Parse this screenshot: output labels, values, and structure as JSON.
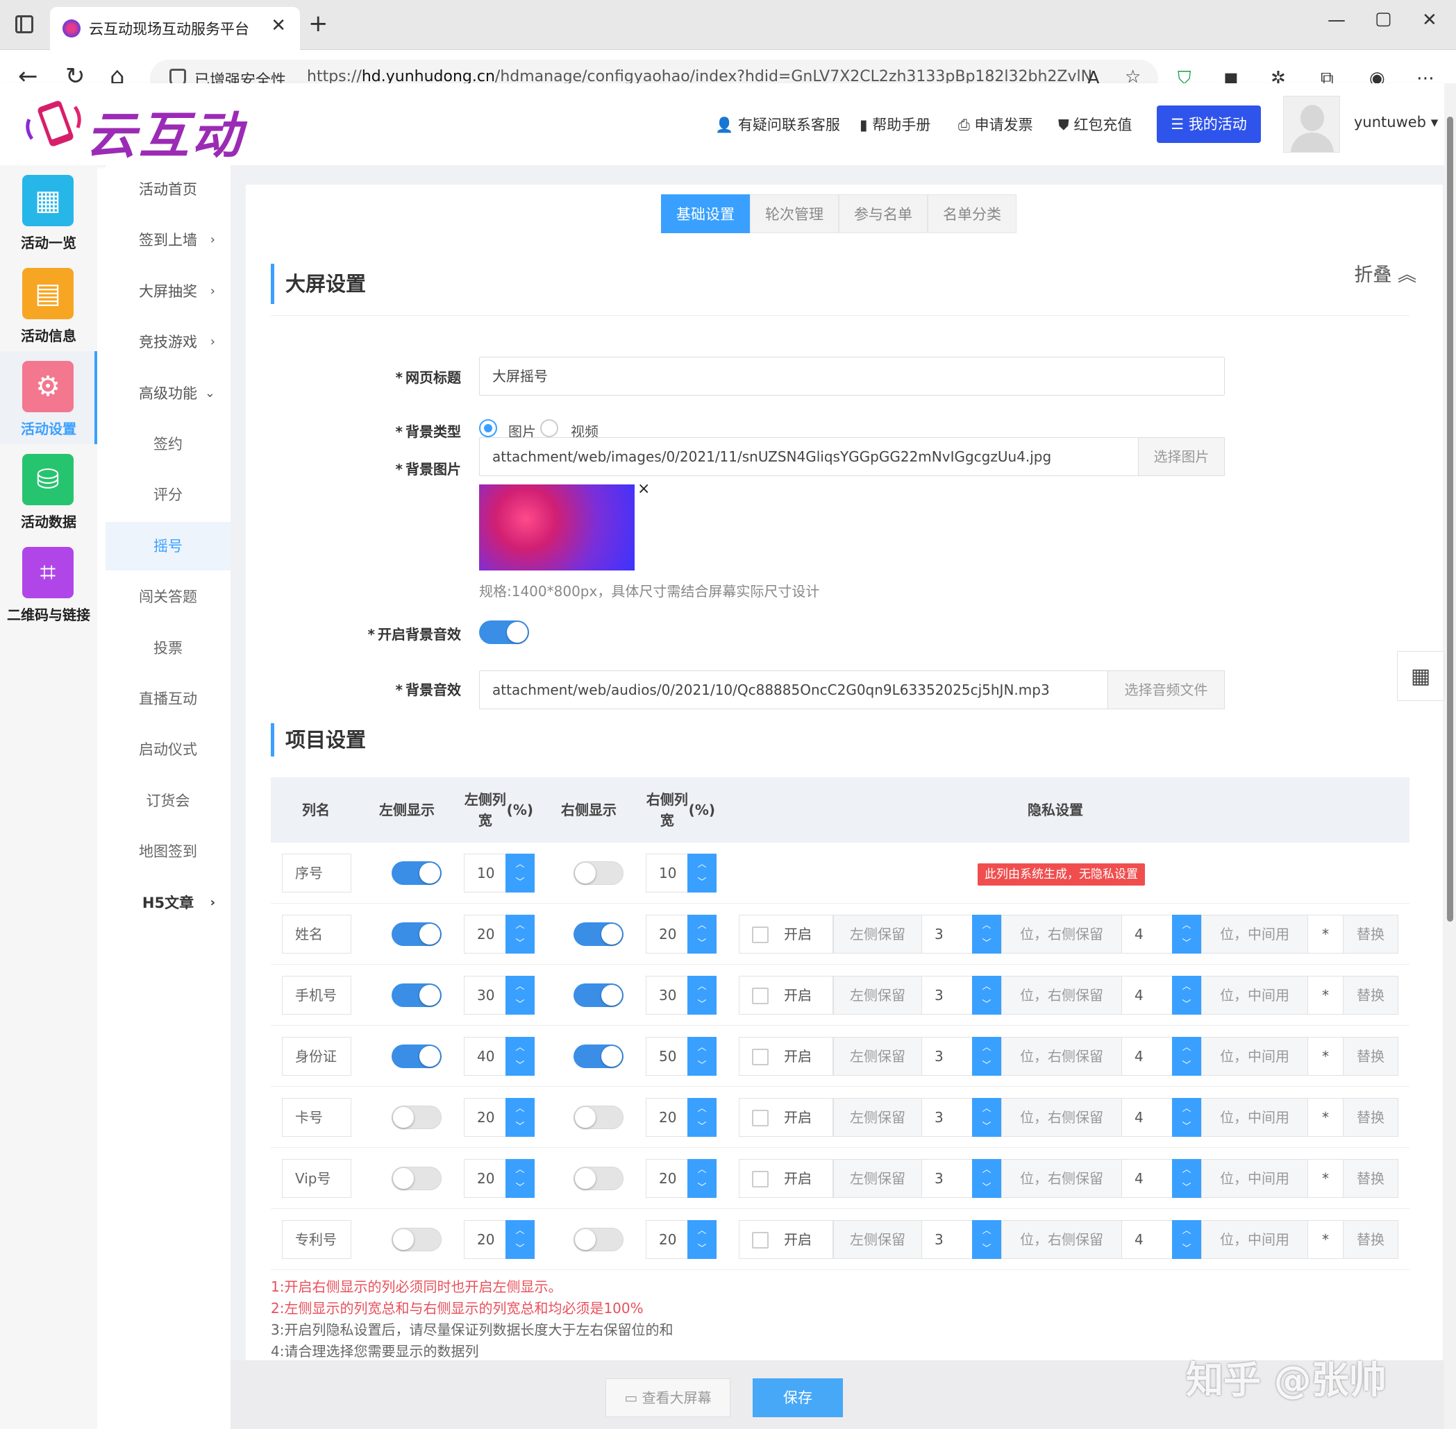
{
  "browser": {
    "tab_title": "云互动现场互动服务平台",
    "security_label": "已增强安全性",
    "url_prefix": "https://",
    "url_host": "hd.yunhudong.cn",
    "url_path": "/hdmanage/configyaohao/index?hdid=GnLV7X2CL2zh3133pBp182l32bh2ZvlN"
  },
  "header": {
    "logo_text": "云互动",
    "links": [
      "有疑问联系客服",
      "帮助手册",
      "申请发票",
      "红包充值"
    ],
    "my_activity": "我的活动",
    "username": "yuntuweb"
  },
  "rail": [
    {
      "label": "活动一览",
      "icon": "grid-icon",
      "color": "#27b6e8",
      "active": false
    },
    {
      "label": "活动信息",
      "icon": "document-icon",
      "color": "#f7a623",
      "active": false
    },
    {
      "label": "活动设置",
      "icon": "gear-icon",
      "color": "#f3778f",
      "active": true
    },
    {
      "label": "活动数据",
      "icon": "database-icon",
      "color": "#27c46f",
      "active": false
    },
    {
      "label": "二维码与链接",
      "icon": "qrcode-icon",
      "color": "#b146e8",
      "active": false
    }
  ],
  "submenu": [
    {
      "label": "活动首页",
      "arrow": ""
    },
    {
      "label": "签到上墙",
      "arrow": "›"
    },
    {
      "label": "大屏抽奖",
      "arrow": "›"
    },
    {
      "label": "竞技游戏",
      "arrow": "›"
    },
    {
      "label": "高级功能",
      "arrow": "⌄"
    },
    {
      "label": "签约",
      "arrow": ""
    },
    {
      "label": "评分",
      "arrow": ""
    },
    {
      "label": "摇号",
      "arrow": ""
    },
    {
      "label": "闯关答题",
      "arrow": ""
    },
    {
      "label": "投票",
      "arrow": ""
    },
    {
      "label": "直播互动",
      "arrow": ""
    },
    {
      "label": "启动仪式",
      "arrow": ""
    },
    {
      "label": "订货会",
      "arrow": ""
    },
    {
      "label": "地图签到",
      "arrow": ""
    },
    {
      "label": "H5文章",
      "arrow": "›"
    }
  ],
  "tabs": [
    "基础设置",
    "轮次管理",
    "参与名单",
    "名单分类"
  ],
  "section1": {
    "title": "大屏设置",
    "fold_label": "折叠",
    "page_title_label": "网页标题",
    "page_title_value": "大屏摇号",
    "bg_type_label": "背景类型",
    "bg_type_options": [
      "图片",
      "视频"
    ],
    "bg_image_label": "背景图片",
    "bg_image_value": "attachment/web/images/0/2021/11/snUZSN4GliqsYGGpGG22mNvIGgcgzUu4.jpg",
    "choose_image": "选择图片",
    "bg_image_hint": "规格:1400*800px，具体尺寸需结合屏幕实际尺寸设计",
    "bg_sound_enable_label": "开启背景音效",
    "bg_sound_label": "背景音效",
    "bg_sound_value": "attachment/web/audios/0/2021/10/Qc88885OncC2G0qn9L63352025cj5hJN.mp3",
    "choose_audio": "选择音频文件",
    "required_mark": "*",
    "remove_mark": "×"
  },
  "section2": {
    "title": "项目设置",
    "headers": {
      "name": "列名",
      "left_show": "左侧显示",
      "left_width": "左侧列宽",
      "left_width_unit": "(%)",
      "right_show": "右侧显示",
      "right_width": "右侧列宽",
      "right_width_unit": "(%)",
      "privacy": "隐私设置"
    },
    "system_badge": "此列由系统生成，无隐私设置",
    "privacy_labels": {
      "enable": "开启",
      "left_keep": "左侧保留",
      "right_keep": "位，右侧保留",
      "middle": "位，中间用",
      "replace": "替换"
    },
    "rows": [
      {
        "name": "序号",
        "left_on": true,
        "left_w": "10",
        "right_on": false,
        "right_w": "10",
        "system": true
      },
      {
        "name": "姓名",
        "left_on": true,
        "left_w": "20",
        "right_on": true,
        "right_w": "20",
        "system": false,
        "lk": "3",
        "rk": "4",
        "ch": "*"
      },
      {
        "name": "手机号",
        "left_on": true,
        "left_w": "30",
        "right_on": true,
        "right_w": "30",
        "system": false,
        "lk": "3",
        "rk": "4",
        "ch": "*"
      },
      {
        "name": "身份证",
        "left_on": true,
        "left_w": "40",
        "right_on": true,
        "right_w": "50",
        "system": false,
        "lk": "3",
        "rk": "4",
        "ch": "*"
      },
      {
        "name": "卡号",
        "left_on": false,
        "left_w": "20",
        "right_on": false,
        "right_w": "20",
        "system": false,
        "lk": "3",
        "rk": "4",
        "ch": "*"
      },
      {
        "name": "Vip号",
        "left_on": false,
        "left_w": "20",
        "right_on": false,
        "right_w": "20",
        "system": false,
        "lk": "3",
        "rk": "4",
        "ch": "*"
      },
      {
        "name": "专利号",
        "left_on": false,
        "left_w": "20",
        "right_on": false,
        "right_w": "20",
        "system": false,
        "lk": "3",
        "rk": "4",
        "ch": "*"
      }
    ],
    "notes": [
      {
        "text": "1:开启右侧显示的列必须同时也开启左侧显示。",
        "color": "#e8505b"
      },
      {
        "text": "2:左侧显示的列宽总和与右侧显示的列宽总和均必须是100%",
        "color": "#e8505b"
      },
      {
        "text": "3:开启列隐私设置后，请尽量保证列数据长度大于左右保留位的和",
        "color": "#666666"
      },
      {
        "text": "4:请合理选择您需要显示的数据列",
        "color": "#666666"
      }
    ]
  },
  "footer": {
    "view_screen": "查看大屏幕",
    "save": "保存"
  },
  "watermark": "知乎 @张帅",
  "colors": {
    "accent": "#3aa0ff",
    "primary_btn": "#2f54eb",
    "danger": "#f04e4e"
  }
}
